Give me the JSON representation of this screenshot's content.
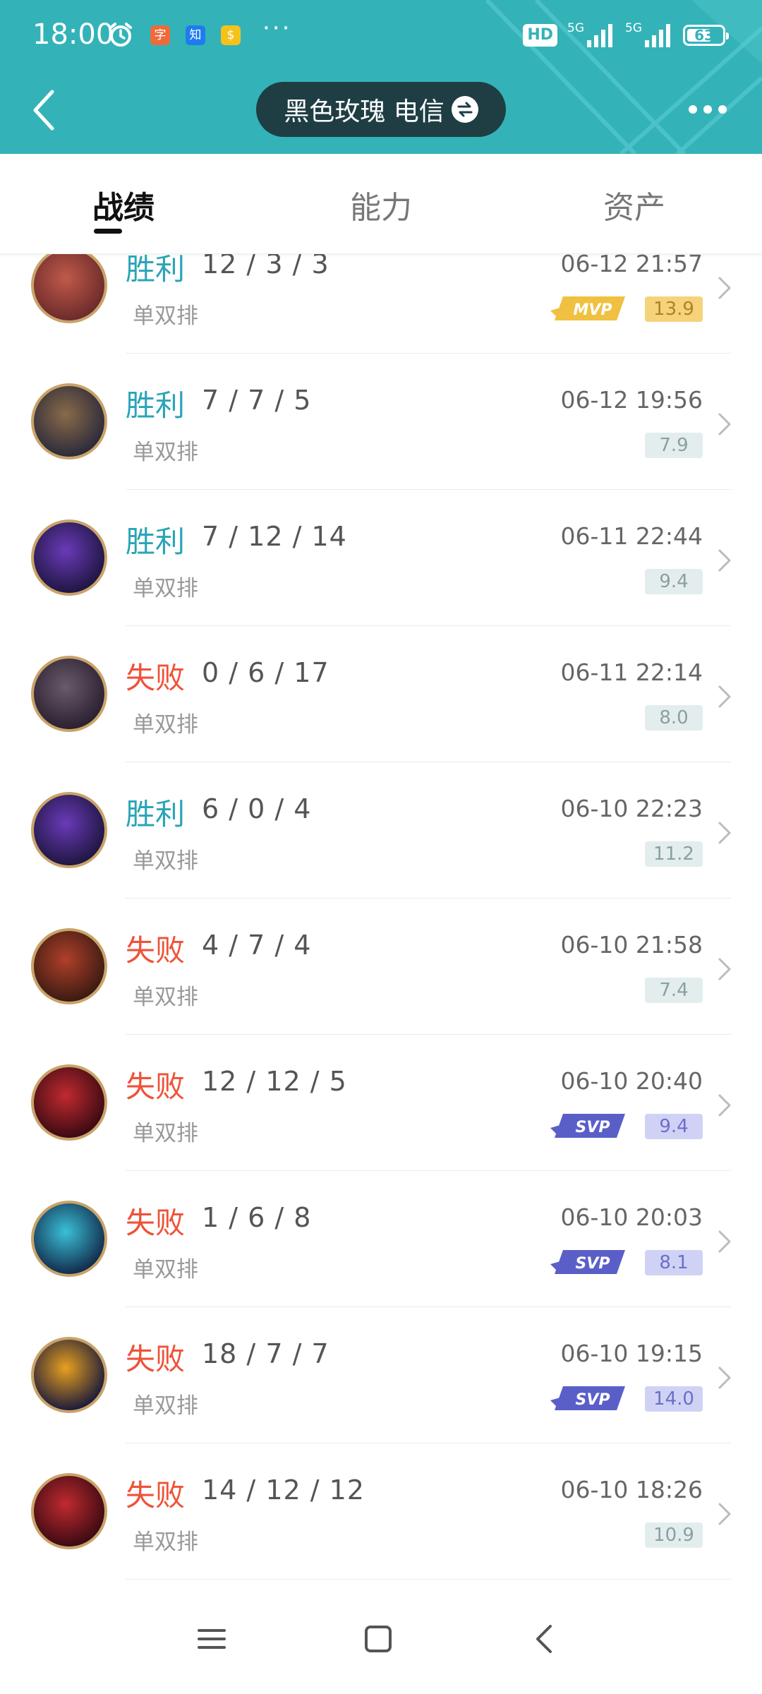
{
  "status_bar": {
    "time": "18:00",
    "app_badges": [
      {
        "icon": "app-badge-red",
        "text": "字",
        "color": "#ee6a3a"
      },
      {
        "icon": "zhihu-icon",
        "text": "知",
        "color": "#1f7cf0"
      },
      {
        "icon": "app-badge-yellow",
        "text": "$",
        "color": "#f5c21c"
      }
    ],
    "overflow": "···",
    "hd_label": "HD",
    "net1": "5G",
    "net2": "5G",
    "battery_level": "63",
    "battery_fraction": 0.63
  },
  "header": {
    "account_name": "黑色玫瑰 电信",
    "colors": {
      "bar": "#33b3b8",
      "pill": "#1e3e44"
    }
  },
  "tabs": [
    {
      "label": "战绩",
      "active": true
    },
    {
      "label": "能力",
      "active": false
    },
    {
      "label": "资产",
      "active": false
    }
  ],
  "matches": [
    {
      "result": "胜利",
      "outcome": "win",
      "kda": "12 / 3 / 3",
      "mode": "单双排",
      "date": "06-12 21:57",
      "score": "13.9",
      "badge": "MVP",
      "hero_colors": [
        "#6b2a2a",
        "#c05a4a"
      ]
    },
    {
      "result": "胜利",
      "outcome": "win",
      "kda": "7 / 7 / 5",
      "mode": "单双排",
      "date": "06-12 19:56",
      "score": "7.9",
      "badge": "",
      "hero_colors": [
        "#2a2a3a",
        "#8a6a4a"
      ]
    },
    {
      "result": "胜利",
      "outcome": "win",
      "kda": "7 / 12 / 14",
      "mode": "单双排",
      "date": "06-11 22:44",
      "score": "9.4",
      "badge": "",
      "hero_colors": [
        "#1e1640",
        "#6a3ab8"
      ]
    },
    {
      "result": "失败",
      "outcome": "loss",
      "kda": "0 / 6 / 17",
      "mode": "单双排",
      "date": "06-11 22:14",
      "score": "8.0",
      "badge": "",
      "hero_colors": [
        "#2a2030",
        "#6a5a6a"
      ]
    },
    {
      "result": "胜利",
      "outcome": "win",
      "kda": "6 / 0 / 4",
      "mode": "单双排",
      "date": "06-10 22:23",
      "score": "11.2",
      "badge": "",
      "hero_colors": [
        "#1e1640",
        "#6a3ab8"
      ]
    },
    {
      "result": "失败",
      "outcome": "loss",
      "kda": "4 / 7 / 4",
      "mode": "单双排",
      "date": "06-10 21:58",
      "score": "7.4",
      "badge": "",
      "hero_colors": [
        "#3a1a12",
        "#b0402a"
      ]
    },
    {
      "result": "失败",
      "outcome": "loss",
      "kda": "12 / 12 / 5",
      "mode": "单双排",
      "date": "06-10 20:40",
      "score": "9.4",
      "badge": "SVP",
      "hero_colors": [
        "#3a0a12",
        "#c02a30"
      ]
    },
    {
      "result": "失败",
      "outcome": "loss",
      "kda": "1 / 6 / 8",
      "mode": "单双排",
      "date": "06-10 20:03",
      "score": "8.1",
      "badge": "SVP",
      "hero_colors": [
        "#122a4a",
        "#3ac0d8"
      ]
    },
    {
      "result": "失败",
      "outcome": "loss",
      "kda": "18 / 7 / 7",
      "mode": "单双排",
      "date": "06-10 19:15",
      "score": "14.0",
      "badge": "SVP",
      "hero_colors": [
        "#1a1a3a",
        "#e8a020"
      ]
    },
    {
      "result": "失败",
      "outcome": "loss",
      "kda": "14 / 12 / 12",
      "mode": "单双排",
      "date": "06-10 18:26",
      "score": "10.9",
      "badge": "",
      "hero_colors": [
        "#3a0a12",
        "#c02a30"
      ]
    }
  ],
  "colors": {
    "win": "#2aa4b8",
    "loss": "#ef5238",
    "mvp": "#f0c040",
    "svp": "#5a5fc8"
  },
  "nav": {
    "icons": [
      "menu-icon",
      "home-square-icon",
      "back-icon"
    ]
  }
}
